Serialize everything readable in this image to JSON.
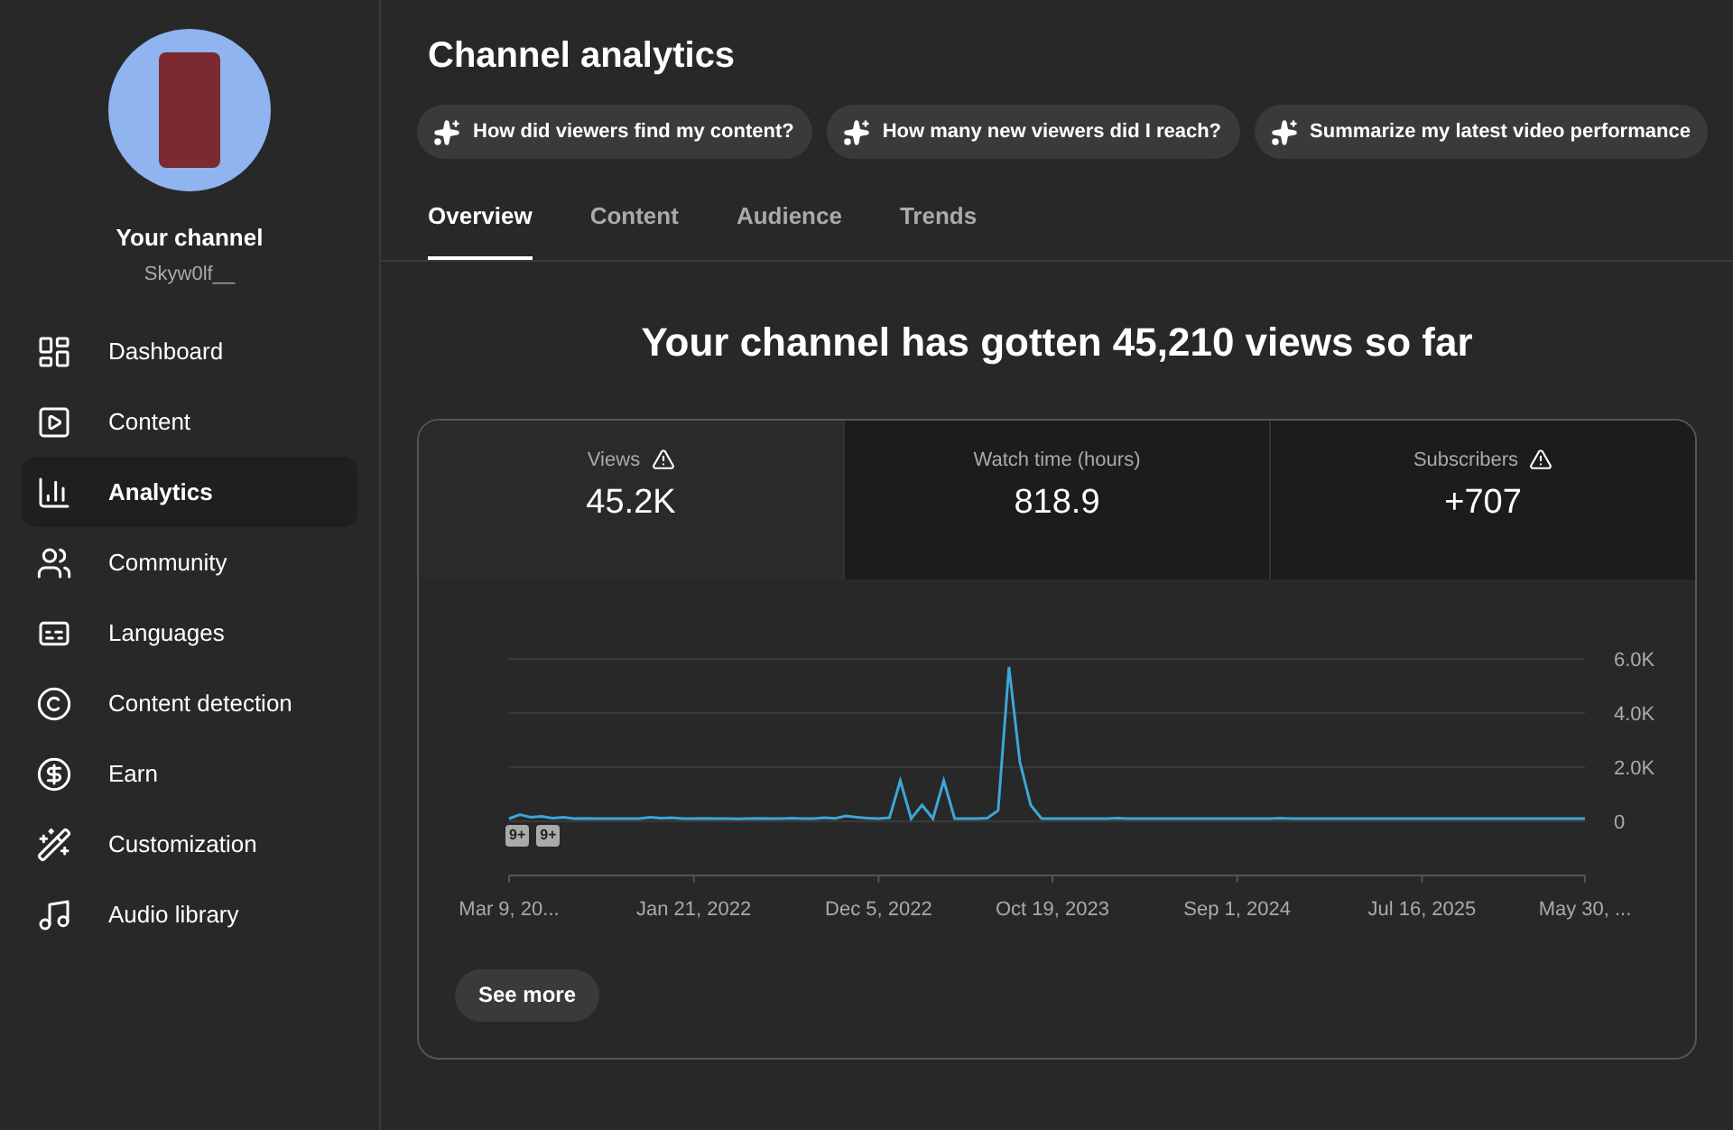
{
  "sidebar": {
    "channel_label": "Your channel",
    "handle": "Skyw0lf__",
    "items": [
      {
        "label": "Dashboard",
        "selected": false
      },
      {
        "label": "Content",
        "selected": false
      },
      {
        "label": "Analytics",
        "selected": true
      },
      {
        "label": "Community",
        "selected": false
      },
      {
        "label": "Languages",
        "selected": false
      },
      {
        "label": "Content detection",
        "selected": false
      },
      {
        "label": "Earn",
        "selected": false
      },
      {
        "label": "Customization",
        "selected": false
      },
      {
        "label": "Audio library",
        "selected": false
      }
    ]
  },
  "header": {
    "title": "Channel analytics",
    "chips": [
      "How did viewers find my content?",
      "How many new viewers did I reach?",
      "Summarize my latest video performance"
    ]
  },
  "tabs": [
    {
      "label": "Overview",
      "selected": true
    },
    {
      "label": "Content",
      "selected": false
    },
    {
      "label": "Audience",
      "selected": false
    },
    {
      "label": "Trends",
      "selected": false
    }
  ],
  "headline": "Your channel has gotten 45,210 views so far",
  "metrics": [
    {
      "label": "Views",
      "value": "45.2K",
      "warning": true,
      "selected": true
    },
    {
      "label": "Watch time (hours)",
      "value": "818.9",
      "warning": false,
      "selected": false
    },
    {
      "label": "Subscribers",
      "value": "+707",
      "warning": true,
      "selected": false
    }
  ],
  "chart_data": {
    "type": "line",
    "grid": true,
    "ylim": [
      0,
      6000
    ],
    "yticks": [
      {
        "value": 0,
        "label": "0"
      },
      {
        "value": 2000,
        "label": "2.0K"
      },
      {
        "value": 4000,
        "label": "4.0K"
      },
      {
        "value": 6000,
        "label": "6.0K"
      }
    ],
    "categories": [
      "Mar 9, 20...",
      null,
      null,
      null,
      null,
      null,
      null,
      null,
      null,
      null,
      null,
      null,
      null,
      null,
      null,
      null,
      null,
      "Jan 21, 2022",
      null,
      null,
      null,
      null,
      null,
      null,
      null,
      null,
      null,
      null,
      null,
      null,
      null,
      null,
      null,
      null,
      "Dec 5, 2022",
      null,
      null,
      null,
      null,
      null,
      null,
      null,
      null,
      null,
      null,
      null,
      null,
      null,
      null,
      null,
      "Oct 19, 2023",
      null,
      null,
      null,
      null,
      null,
      null,
      null,
      null,
      null,
      null,
      null,
      null,
      null,
      null,
      null,
      null,
      "Sep 1, 2024",
      null,
      null,
      null,
      null,
      null,
      null,
      null,
      null,
      null,
      null,
      null,
      null,
      null,
      null,
      null,
      null,
      "Jul 16, 2025",
      null,
      null,
      null,
      null,
      null,
      null,
      null,
      null,
      null,
      null,
      null,
      null,
      null,
      null,
      "May 30, ..."
    ],
    "series": [
      {
        "color": "#3ea6d8",
        "values": [
          100,
          250,
          150,
          180,
          120,
          150,
          100,
          110,
          100,
          100,
          100,
          100,
          100,
          150,
          120,
          130,
          100,
          100,
          110,
          100,
          100,
          90,
          100,
          110,
          100,
          100,
          120,
          100,
          100,
          130,
          110,
          200,
          150,
          120,
          100,
          130,
          1500,
          100,
          600,
          100,
          1500,
          100,
          100,
          100,
          120,
          400,
          5700,
          2200,
          600,
          100,
          100,
          100,
          100,
          100,
          100,
          100,
          120,
          100,
          100,
          100,
          100,
          100,
          100,
          100,
          100,
          100,
          100,
          100,
          100,
          100,
          100,
          120,
          100,
          100,
          100,
          100,
          100,
          100,
          100,
          100,
          100,
          100,
          100,
          100,
          100,
          100,
          100,
          100,
          100,
          100,
          100,
          100,
          100,
          100,
          100,
          100,
          100,
          100,
          100,
          100
        ]
      }
    ]
  },
  "badges": [
    "9+",
    "9+"
  ],
  "see_more": "See more"
}
